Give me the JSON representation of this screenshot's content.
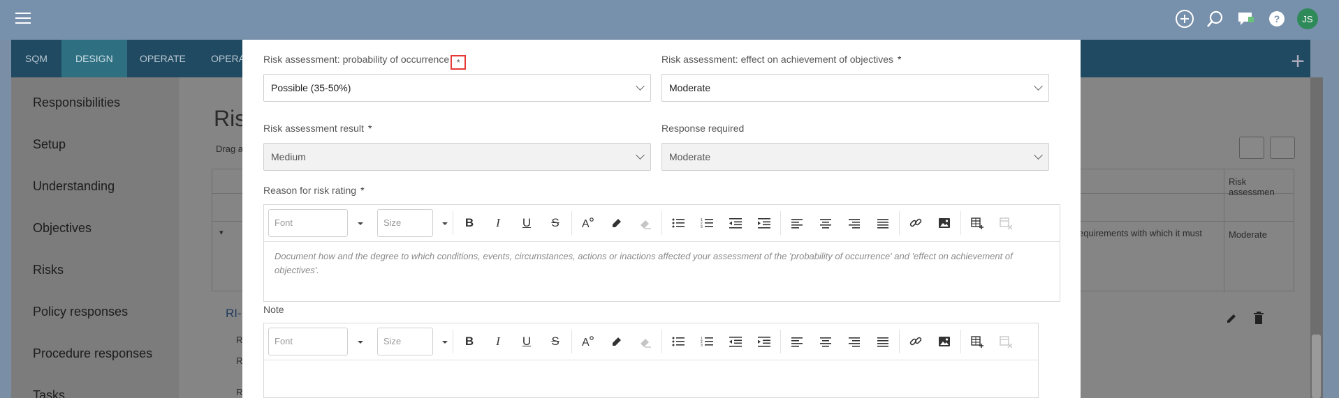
{
  "topbar": {
    "icons": [
      "menu-icon",
      "add-circle-icon",
      "search-icon",
      "chat-icon",
      "help-icon"
    ],
    "avatar_initials": "JS"
  },
  "nav": {
    "items": [
      "SQM",
      "DESIGN",
      "OPERATE",
      "OPERA"
    ],
    "active": "DESIGN"
  },
  "sidebar": {
    "items": [
      "Responsibilities",
      "Setup",
      "Understanding",
      "Objectives",
      "Risks",
      "Policy responses",
      "Procedure responses",
      "Tasks"
    ]
  },
  "background": {
    "page_title_fragment": "Ris",
    "hint_fragment": "Drag a",
    "table_header_fragment": "Risk assessmen",
    "row_text_fragment": "equirements with which it must",
    "row_value": "Moderate",
    "row_id_fragment": "RI-",
    "row_sub_fragments": [
      "R",
      "R",
      "R"
    ]
  },
  "form": {
    "probability": {
      "label": "Risk assessment: probability of occurrence",
      "required_mark": "*",
      "value": "Possible (35-50%)"
    },
    "effect": {
      "label": "Risk assessment: effect on achievement of objectives",
      "required_mark": "*",
      "value": "Moderate"
    },
    "result": {
      "label": "Risk assessment result",
      "required_mark": "*",
      "value": "Medium"
    },
    "response": {
      "label": "Response required",
      "value": "Moderate"
    },
    "reason": {
      "label": "Reason for risk rating",
      "required_mark": "*",
      "placeholder": "Document how and the degree to which conditions, events, circumstances, actions or inactions affected your assessment of the 'probability of occurrence' and 'effect on achievement of objectives'."
    },
    "note": {
      "label": "Note"
    }
  },
  "toolbar": {
    "font_placeholder": "Font",
    "size_placeholder": "Size",
    "buttons": {
      "bold": "B",
      "italic": "I",
      "underline": "U",
      "strike": "S"
    }
  }
}
